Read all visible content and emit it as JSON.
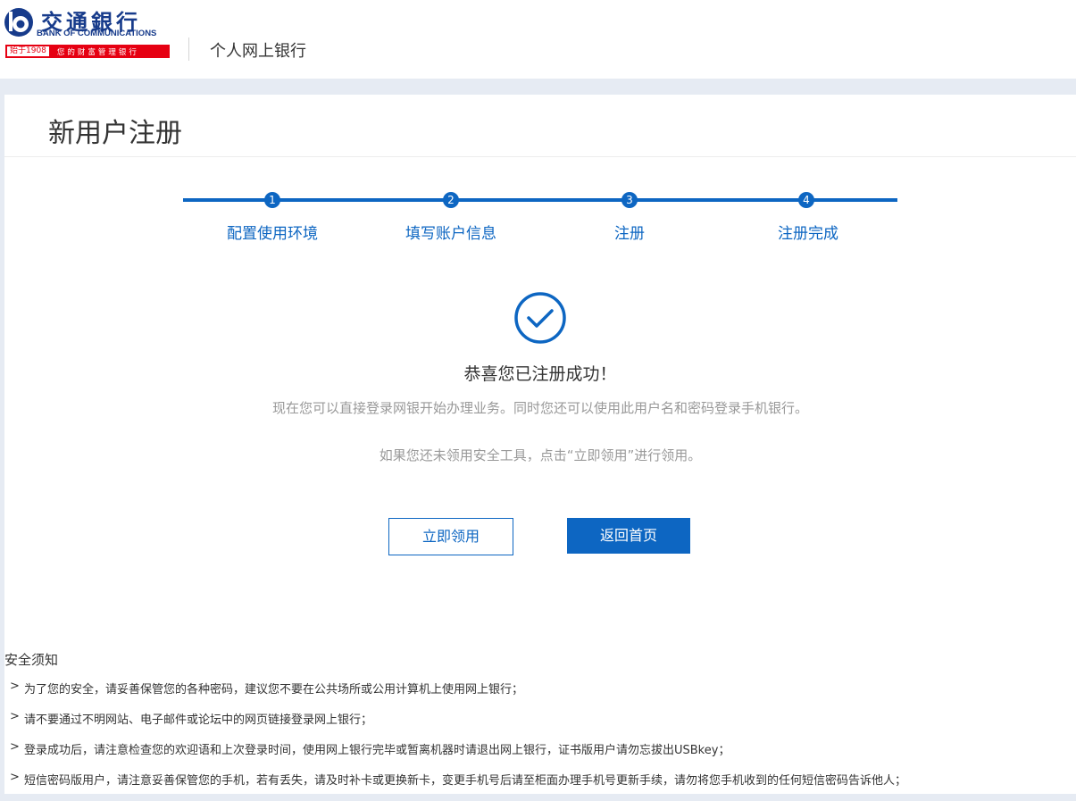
{
  "header": {
    "logo": {
      "cn": "交通銀行",
      "en": "BANK OF COMMUNICATIONS",
      "year": "始于1908",
      "slogan": "您的财富管理银行",
      "brand_color": "#173b8b",
      "slogan_color": "#e60012"
    },
    "title": "个人网上银行"
  },
  "page": {
    "title": "新用户注册"
  },
  "steps": [
    {
      "number": "1",
      "label": "配置使用环境"
    },
    {
      "number": "2",
      "label": "填写账户信息"
    },
    {
      "number": "3",
      "label": "注册"
    },
    {
      "number": "4",
      "label": "注册完成"
    }
  ],
  "result": {
    "icon": "check-circle-icon",
    "title": "恭喜您已注册成功！",
    "line1": "现在您可以直接登录网银开始办理业务。同时您还可以使用此用户名和密码登录手机银行。",
    "line2": "如果您还未领用安全工具，点击“立即领用”进行领用。"
  },
  "buttons": {
    "claim": "立即领用",
    "home": "返回首页"
  },
  "security": {
    "title": "安全须知",
    "marker": ">",
    "items": [
      "为了您的安全，请妥善保管您的各种密码，建议您不要在公共场所或公用计算机上使用网上银行；",
      "请不要通过不明网站、电子邮件或论坛中的网页链接登录网上银行；",
      "登录成功后，请注意检查您的欢迎语和上次登录时间，使用网上银行完毕或暂离机器时请退出网上银行，证书版用户请勿忘拔出USBkey；",
      "短信密码版用户，请注意妥善保管您的手机，若有丢失，请及时补卡或更换新卡，变更手机号后请至柜面办理手机号更新手续，请勿将您手机收到的任何短信密码告诉他人；"
    ]
  },
  "colors": {
    "accent": "#0d66c2",
    "background": "#e6ebf3",
    "muted_text": "#999999"
  }
}
